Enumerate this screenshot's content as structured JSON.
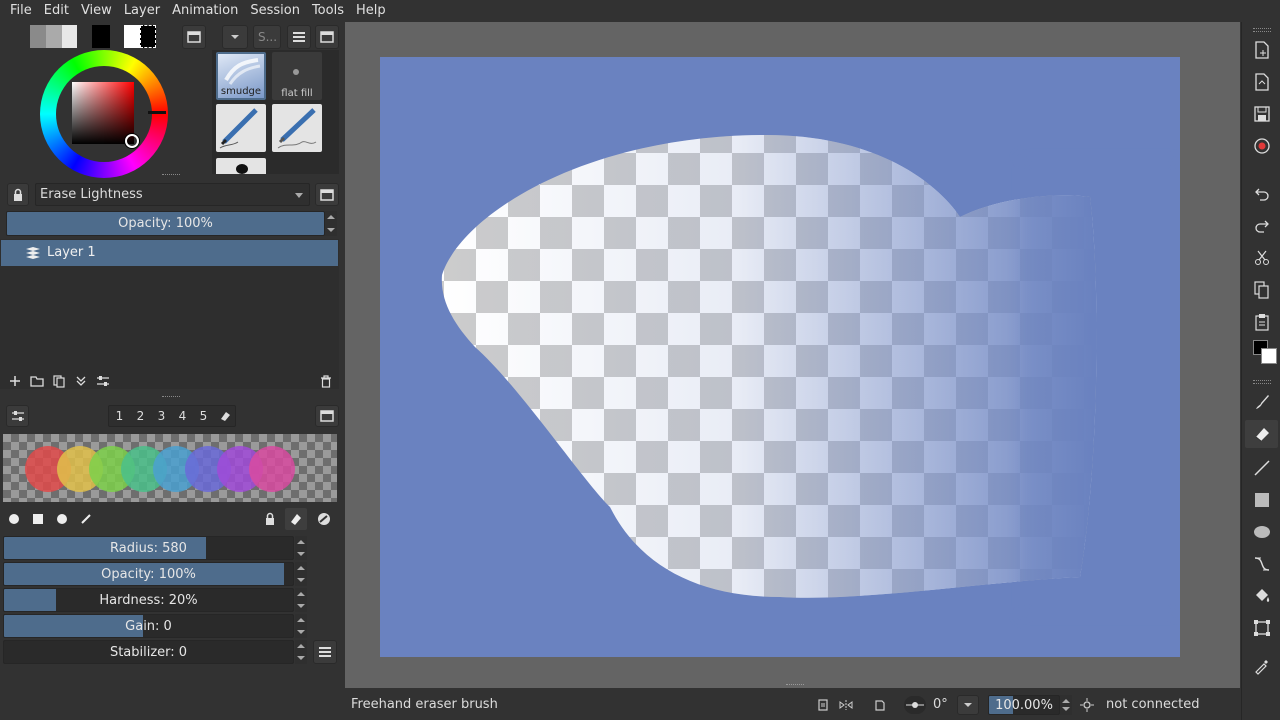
{
  "menu": [
    "File",
    "Edit",
    "View",
    "Layer",
    "Animation",
    "Session",
    "Tools",
    "Help"
  ],
  "color_selector": {
    "foreground": "#000000",
    "background": "#ffffff",
    "hue_color": "#ff0000"
  },
  "brush_presets": {
    "search_placeholder": "S...",
    "items": [
      {
        "label": "smudge"
      },
      {
        "label": "flat fill"
      }
    ]
  },
  "blending_mode": "Erase Lightness",
  "layer_opacity": {
    "label": "Opacity: 100%",
    "value": 1.0
  },
  "layers": [
    {
      "name": "Layer 1",
      "selected": true
    }
  ],
  "brush_slot_tabs": [
    "1",
    "2",
    "3",
    "4",
    "5"
  ],
  "palette_colors": [
    "#e04a4a",
    "#e0c04a",
    "#7cd04a",
    "#4ac08a",
    "#4aa0d0",
    "#6a6ad8",
    "#a04ad8",
    "#d84aa0"
  ],
  "brush_settings": [
    {
      "label": "Radius: 580",
      "fraction": 0.7
    },
    {
      "label": "Opacity: 100%",
      "fraction": 0.97
    },
    {
      "label": "Hardness: 20%",
      "fraction": 0.18
    },
    {
      "label": "Gain: 0",
      "fraction": 0.48
    },
    {
      "label": "Stabilizer: 0",
      "fraction": 0.0
    }
  ],
  "canvas": {
    "background_color": "#6a82c0"
  },
  "status": {
    "tool_name": "Freehand eraser brush",
    "rotation": "0°",
    "zoom": "100.00%",
    "connection": "not connected"
  },
  "colors": {
    "accent": "#4e6c8c",
    "panel": "#323232",
    "canvas_bg": "#646464"
  }
}
